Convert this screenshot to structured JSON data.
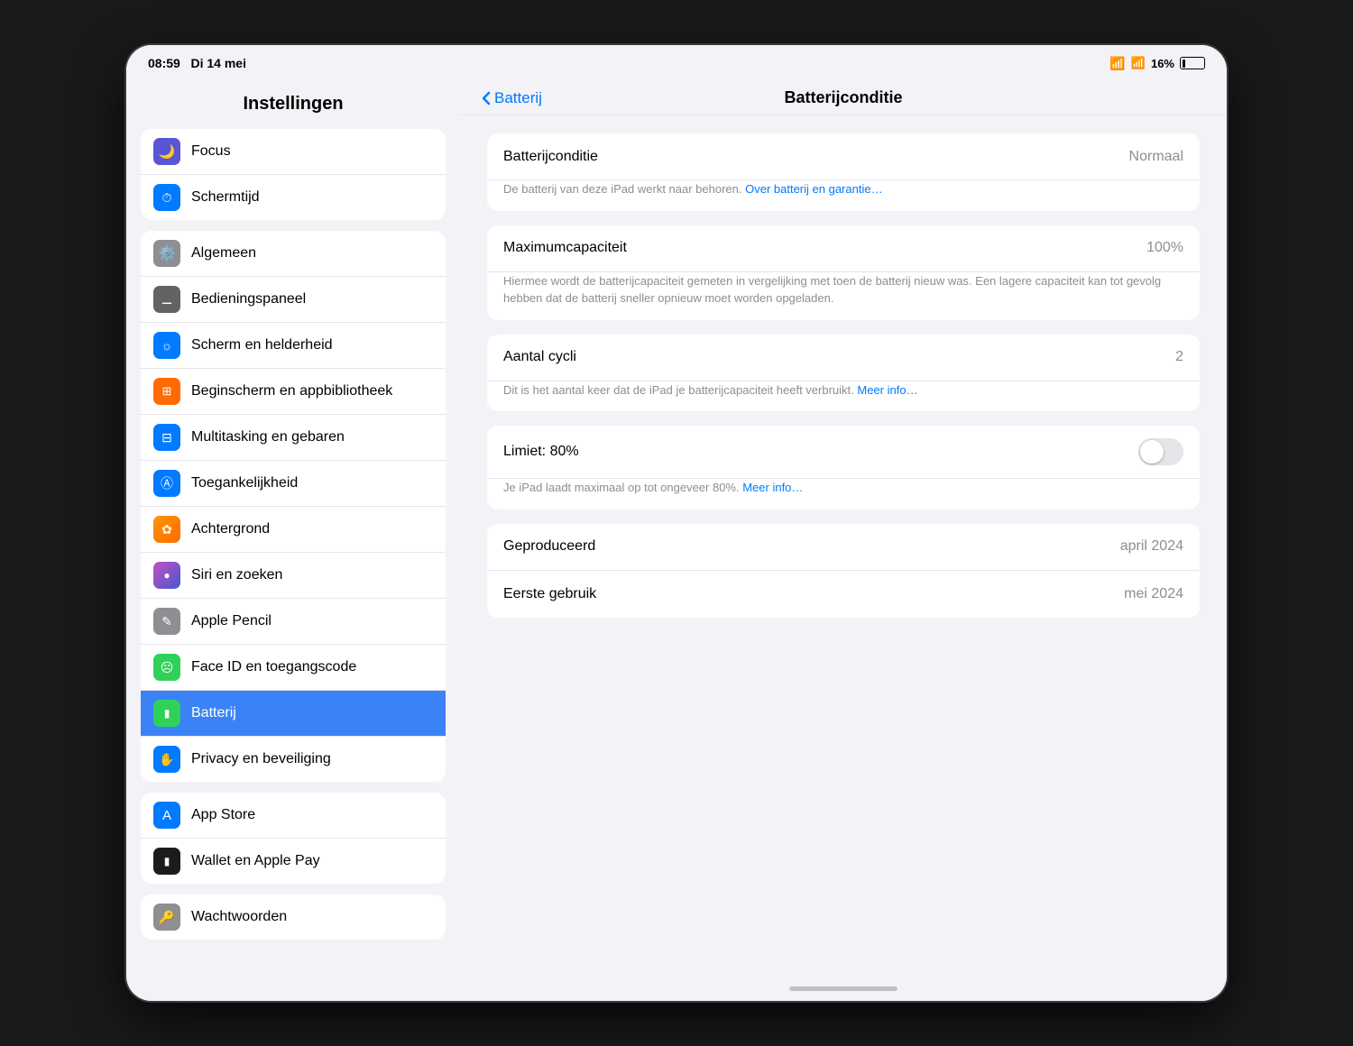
{
  "statusBar": {
    "time": "08:59",
    "date": "Di 14 mei",
    "wifi": "wifi",
    "signal": "signal",
    "battery": "16%"
  },
  "sidebar": {
    "title": "Instellingen",
    "groups": [
      {
        "id": "group1",
        "items": [
          {
            "id": "focus",
            "label": "Focus",
            "icon": "🌙",
            "iconClass": "icon-focus"
          },
          {
            "id": "screentime",
            "label": "Schermtijd",
            "icon": "⏱",
            "iconClass": "icon-screentime"
          }
        ]
      },
      {
        "id": "group2",
        "items": [
          {
            "id": "general",
            "label": "Algemeen",
            "icon": "⚙️",
            "iconClass": "icon-general"
          },
          {
            "id": "control",
            "label": "Bedieningspaneel",
            "icon": "▦",
            "iconClass": "icon-control"
          },
          {
            "id": "display",
            "label": "Scherm en helderheid",
            "icon": "✦",
            "iconClass": "icon-display"
          },
          {
            "id": "homescreen",
            "label": "Beginscherm en appbibliotheek",
            "icon": "⊞",
            "iconClass": "icon-homescreen"
          },
          {
            "id": "multitask",
            "label": "Multitasking en gebaren",
            "icon": "⊟",
            "iconClass": "icon-multitask"
          },
          {
            "id": "accessibility",
            "label": "Toegankelijkheid",
            "icon": "⓪",
            "iconClass": "icon-accessibility"
          },
          {
            "id": "wallpaper",
            "label": "Achtergrond",
            "icon": "✿",
            "iconClass": "icon-wallpaper"
          },
          {
            "id": "siri",
            "label": "Siri en zoeken",
            "icon": "◎",
            "iconClass": "icon-siri"
          },
          {
            "id": "pencil",
            "label": "Apple Pencil",
            "icon": "✏",
            "iconClass": "icon-pencil"
          },
          {
            "id": "faceid",
            "label": "Face ID en toegangscode",
            "icon": "◉",
            "iconClass": "icon-faceid"
          },
          {
            "id": "battery",
            "label": "Batterij",
            "icon": "▬",
            "iconClass": "icon-battery",
            "active": true
          },
          {
            "id": "privacy",
            "label": "Privacy en beveiliging",
            "icon": "✋",
            "iconClass": "icon-privacy"
          }
        ]
      },
      {
        "id": "group3",
        "items": [
          {
            "id": "appstore",
            "label": "App Store",
            "icon": "A",
            "iconClass": "icon-appstore"
          },
          {
            "id": "wallet",
            "label": "Wallet en Apple Pay",
            "icon": "▬",
            "iconClass": "icon-wallet"
          }
        ]
      },
      {
        "id": "group4",
        "items": [
          {
            "id": "passwords",
            "label": "Wachtwoorden",
            "icon": "🔑",
            "iconClass": "icon-passwords"
          }
        ]
      }
    ]
  },
  "detailHeader": {
    "backLabel": "Batterij",
    "title": "Batterijconditie"
  },
  "detailSections": [
    {
      "id": "section-condition",
      "rows": [
        {
          "id": "batterijconditie",
          "label": "Batterijconditie",
          "value": "Normaal",
          "description": "De batterij van deze iPad werkt naar behoren.",
          "linkText": "Over batterij en garantie…",
          "linkUrl": "#"
        }
      ]
    },
    {
      "id": "section-capacity",
      "rows": [
        {
          "id": "maximumcapaciteit",
          "label": "Maximumcapaciteit",
          "value": "100%",
          "description": "Hiermee wordt de batterijcapaciteit gemeten in vergelijking met toen de batterij nieuw was. Een lagere capaciteit kan tot gevolg hebben dat de batterij sneller opnieuw moet worden opgeladen.",
          "linkText": null
        }
      ]
    },
    {
      "id": "section-cycles",
      "rows": [
        {
          "id": "aantal-cycli",
          "label": "Aantal cycli",
          "value": "2",
          "description": "Dit is het aantal keer dat de iPad je batterijcapaciteit heeft verbruikt.",
          "linkText": "Meer info…",
          "linkUrl": "#"
        }
      ]
    },
    {
      "id": "section-limiet",
      "rows": [
        {
          "id": "limiet",
          "label": "Limiet: 80%",
          "value": null,
          "toggle": true,
          "toggleOn": false,
          "description": "Je iPad laadt maximaal op tot ongeveer 80%.",
          "linkText": "Meer info…",
          "linkUrl": "#"
        }
      ]
    },
    {
      "id": "section-dates",
      "rows": [
        {
          "id": "geproduceerd",
          "label": "Geproduceerd",
          "value": "april 2024"
        },
        {
          "id": "eerste-gebruik",
          "label": "Eerste gebruik",
          "value": "mei 2024"
        }
      ]
    }
  ]
}
